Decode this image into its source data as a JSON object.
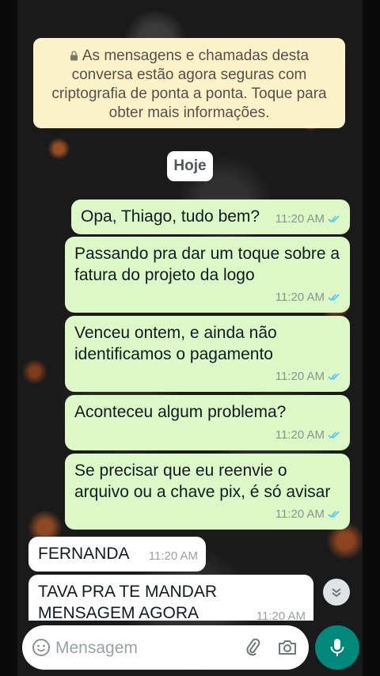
{
  "chat": {
    "encryption_notice": "As mensagens e chamadas desta conversa estão agora seguras com criptografia de ponta a ponta. Toque para obter mais informações.",
    "date_label": "Hoje",
    "messages": [
      {
        "direction": "out",
        "text": "Opa, Thiago, tudo bem?",
        "time": "11:20 AM",
        "status": "read"
      },
      {
        "direction": "out",
        "text": "Passando pra dar um toque sobre a fatura do projeto da logo",
        "time": "11:20 AM",
        "status": "read"
      },
      {
        "direction": "out",
        "text": "Venceu ontem, e ainda não identificamos o pagamento",
        "time": "11:20 AM",
        "status": "read"
      },
      {
        "direction": "out",
        "text": "Aconteceu algum problema?",
        "time": "11:20 AM",
        "status": "read"
      },
      {
        "direction": "out",
        "text": "Se precisar que eu reenvie o arquivo ou a chave pix, é só avisar",
        "time": "11:20 AM",
        "status": "read"
      },
      {
        "direction": "in",
        "text": "FERNANDA",
        "time": "11:20 AM"
      },
      {
        "direction": "in",
        "text": "TAVA PRA TE MANDAR MENSAGEM AGORA",
        "time": "11:20 AM"
      }
    ]
  },
  "composer": {
    "placeholder": "Mensagem"
  },
  "colors": {
    "outgoing_bubble": "#dcf8c6",
    "incoming_bubble": "#ffffff",
    "notice_bg": "#fbf3c7",
    "read_tick": "#4fc3f7",
    "accent": "#00897b"
  },
  "icons": [
    "lock-icon",
    "double-check-icon",
    "chevron-down-icon",
    "emoji-icon",
    "attach-icon",
    "camera-icon",
    "mic-icon"
  ]
}
